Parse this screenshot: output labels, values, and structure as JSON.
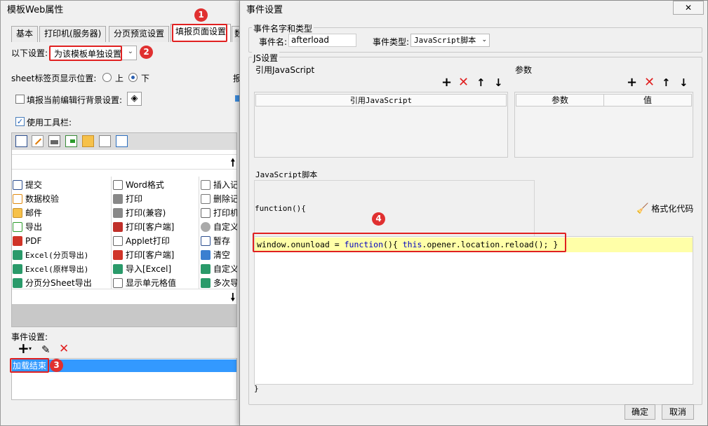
{
  "left_window": {
    "title": "模板Web属性",
    "tabs": [
      "基本",
      "打印机(服务器)",
      "分页预览设置",
      "填报页面设置",
      "数"
    ],
    "setting_label": "以下设置:",
    "setting_value": "为该模板单独设置",
    "sheet_pos_label": "sheet标签页显示位置:",
    "sheet_pos_top": "上",
    "sheet_pos_bottom": "下",
    "edit_bg_label": "填报当前编辑行背景设置:",
    "use_toolbar_label": "使用工具栏:",
    "right_clip_1": "报",
    "toolbar_items": [
      [
        "提交",
        "Word格式",
        "插入记"
      ],
      [
        "数据校验",
        "打印",
        "删除记"
      ],
      [
        "邮件",
        "打印(兼容)",
        "打印机"
      ],
      [
        "导出",
        "打印[客户端]",
        "自定义"
      ],
      [
        "PDF",
        "Applet打印",
        "暂存"
      ],
      [
        "Excel(分页导出)",
        "打印[客户端]",
        "清空"
      ],
      [
        "Excel(原样导出)",
        "导入[Excel]",
        "自定义"
      ],
      [
        "分页分Sheet导出",
        "显示单元格值",
        "多次导"
      ]
    ],
    "event_settings_label": "事件设置:",
    "event_item": "加载结束"
  },
  "right_window": {
    "title": "事件设置",
    "close_glyph": "✕",
    "group_name_type": "事件名字和类型",
    "event_name_label": "事件名:",
    "event_name_value": "afterload",
    "event_type_label": "事件类型:",
    "event_type_value": "JavaScript脚本",
    "group_js": "JS设置",
    "ref_js_label": "引用JavaScript",
    "ref_js_header": "引用JavaScript",
    "params_label": "参数",
    "params_header_param": "参数",
    "params_header_value": "值",
    "js_script_label": "JavaScript脚本",
    "function_open": "function(){",
    "format_code": "格式化代码",
    "code_line": {
      "p1": "window.onunload = ",
      "kw1": "function",
      "p2": "(){ ",
      "kw2": "this",
      "p3": ".opener.location.reload(); }"
    },
    "function_close": "}",
    "ok_button": "确定",
    "cancel_button": "取消"
  },
  "badges": [
    "1",
    "2",
    "3",
    "4"
  ],
  "colors": {
    "annotation_red": "#e02020",
    "selection_blue": "#3399ff",
    "code_highlight": "#ffffa8",
    "keyword_blue": "#0000c0"
  }
}
